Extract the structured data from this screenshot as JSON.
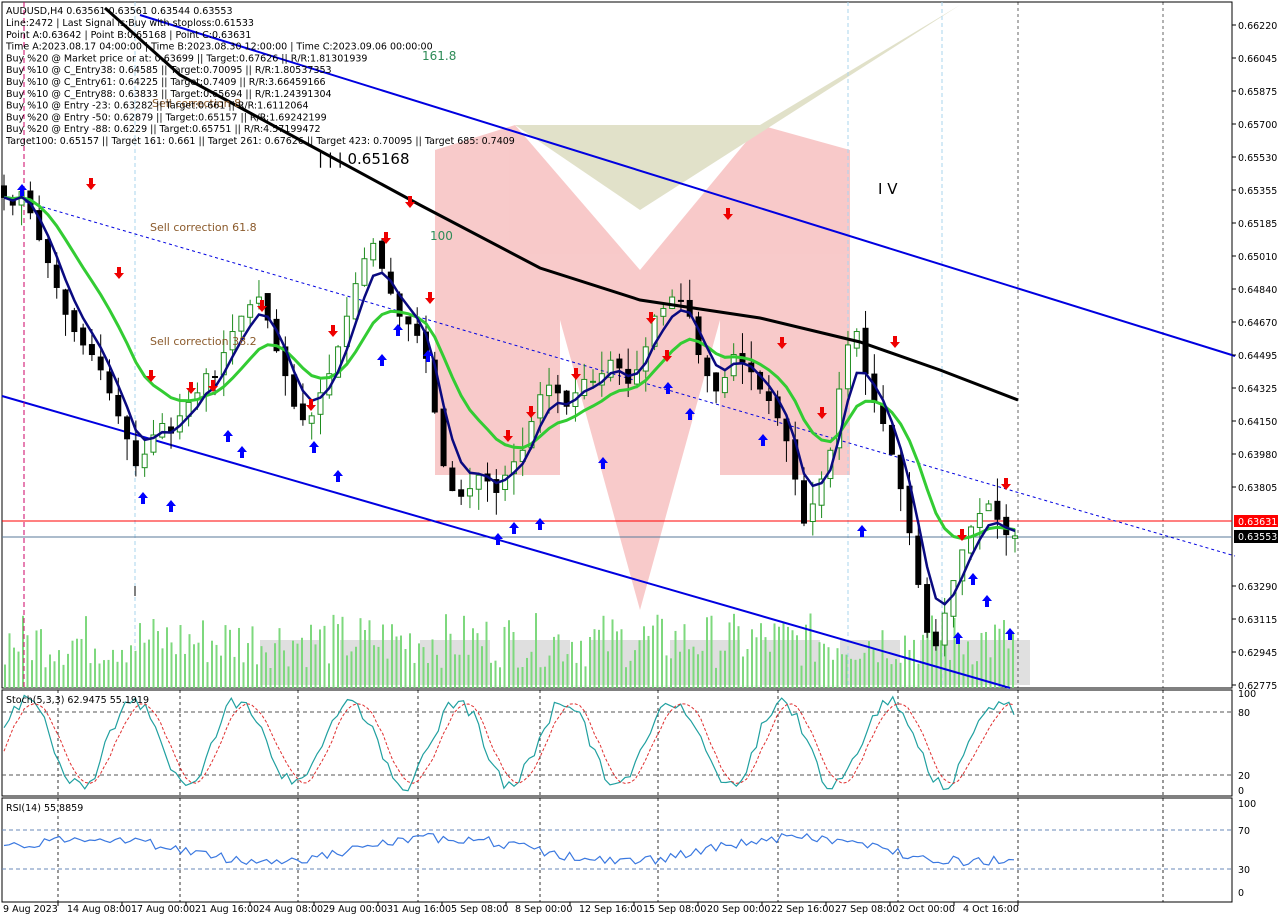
{
  "header": {
    "symbol_line": "AUDUSD,H4  0.63561 0.63561 0.63544 0.63553",
    "info_lines": [
      "Line:2472 | Last Signal is:Buy with stoploss:0.61533",
      "Point A:0.63642 | Point B:0.65168 | Point C:0.63631",
      "Time A:2023.08.17 04:00:00 | Time B:2023.08.30 12:00:00 | Time C:2023.09.06 00:00:00",
      "Buy %20 @ Market price or at: 0.63699 || Target:0.67626 || R/R:1.81301939",
      "Buy %10 @ C_Entry38: 0.64585 || Target:0.70095 || R/R:1.80537353",
      "Buy %10 @ C_Entry61: 0.64225 || Target:0.7409 || R/R:3.66459166",
      "Buy %10 @ C_Entry88: 0.63833 || Target:0.65694 || R/R:1.24391304",
      "Buy %10 @ Entry -23: 0.63282 || Target:0.661 || R/R:1.6112064",
      "Buy %20 @ Entry -50: 0.62879 || Target:0.65157 || R/R:1.69242199",
      "Buy %20 @ Entry -88: 0.6229 || Target:0.65751 || R/R:4.57199472",
      "Target100: 0.65157 || Target 161: 0.661 || Target 261: 0.67626 || Target 423: 0.70095 || Target 685: 0.7409"
    ]
  },
  "annotations": {
    "fib_161": "161.8",
    "fib_100": "100",
    "wave_label": "| | | 0.65168",
    "wave_iv": "I V",
    "sell_corr_61": "Sell correction 61.8",
    "sell_corr_38": "Sell correction 38.2",
    "sell_corr_top": "Sell correction 8"
  },
  "price_axis": {
    "ticks": [
      "0.66220",
      "0.66045",
      "0.65875",
      "0.65700",
      "0.65530",
      "0.65355",
      "0.65185",
      "0.65010",
      "0.64840",
      "0.64670",
      "0.64495",
      "0.64325",
      "0.64150",
      "0.63980",
      "0.63805",
      "0.63290",
      "0.63115",
      "0.62945",
      "0.62775"
    ],
    "current_price": "0.63553",
    "red_level": "0.63631"
  },
  "time_axis": {
    "ticks": [
      "9 Aug 2023",
      "14 Aug 08:00",
      "17 Aug 00:00",
      "21 Aug 16:00",
      "24 Aug 08:00",
      "29 Aug 00:00",
      "31 Aug 16:00",
      "5 Sep 08:00",
      "8 Sep 00:00",
      "12 Sep 16:00",
      "15 Sep 08:00",
      "20 Sep 00:00",
      "22 Sep 16:00",
      "27 Sep 08:00",
      "2 Oct 00:00",
      "4 Oct 16:00"
    ]
  },
  "stoch": {
    "label": "Stoch(5,3,3) 62.9475 55.1919",
    "levels": [
      "80",
      "20"
    ],
    "axis": [
      "100",
      "80",
      "20",
      "0"
    ]
  },
  "rsi": {
    "label": "RSI(14) 55.8859",
    "axis": [
      "100",
      "70",
      "30",
      "0"
    ]
  },
  "colors": {
    "bull": "#1e8c1e",
    "bear": "#000000",
    "channel": "#0000e0",
    "ma_black": "#000000",
    "ma_green": "#33cc33",
    "ma_navy": "#0a0a80",
    "red_line": "#ff0000",
    "buy_arrow": "#0000ff",
    "sell_arrow": "#ee0000"
  },
  "chart_data": {
    "type": "candlestick",
    "symbol": "AUDUSD",
    "timeframe": "H4",
    "ylim": [
      0.62775,
      0.6622
    ],
    "last_close": 0.63553,
    "points": {
      "A": 0.63642,
      "B": 0.65168,
      "C": 0.63631
    },
    "close_series": [
      0.6532,
      0.6528,
      0.6535,
      0.6524,
      0.651,
      0.6498,
      0.6485,
      0.6471,
      0.6462,
      0.6455,
      0.645,
      0.6442,
      0.643,
      0.6418,
      0.6406,
      0.6392,
      0.6398,
      0.6408,
      0.6414,
      0.6409,
      0.6418,
      0.6425,
      0.643,
      0.644,
      0.6438,
      0.6451,
      0.6462,
      0.647,
      0.6476,
      0.648,
      0.6468,
      0.6452,
      0.6439,
      0.6423,
      0.6416,
      0.6418,
      0.643,
      0.644,
      0.6454,
      0.647,
      0.6487,
      0.65,
      0.6508,
      0.6495,
      0.6482,
      0.647,
      0.6466,
      0.646,
      0.6448,
      0.642,
      0.6392,
      0.6379,
      0.6376,
      0.638,
      0.6387,
      0.6384,
      0.6378,
      0.6387,
      0.6394,
      0.64,
      0.6415,
      0.6429,
      0.6434,
      0.643,
      0.6423,
      0.643,
      0.6437,
      0.6436,
      0.644,
      0.6447,
      0.6443,
      0.6435,
      0.6442,
      0.6454,
      0.647,
      0.6474,
      0.648,
      0.6478,
      0.647,
      0.645,
      0.6439,
      0.6431,
      0.6438,
      0.645,
      0.6446,
      0.6441,
      0.6432,
      0.6426,
      0.6417,
      0.6405,
      0.6385,
      0.6362,
      0.6372,
      0.6385,
      0.64,
      0.6432,
      0.6455,
      0.6462,
      0.644,
      0.6425,
      0.6414,
      0.6398,
      0.638,
      0.6357,
      0.633,
      0.6305,
      0.6298,
      0.6315,
      0.6332,
      0.6348,
      0.636,
      0.6367,
      0.6372,
      0.6364,
      0.6356,
      0.63553
    ]
  }
}
